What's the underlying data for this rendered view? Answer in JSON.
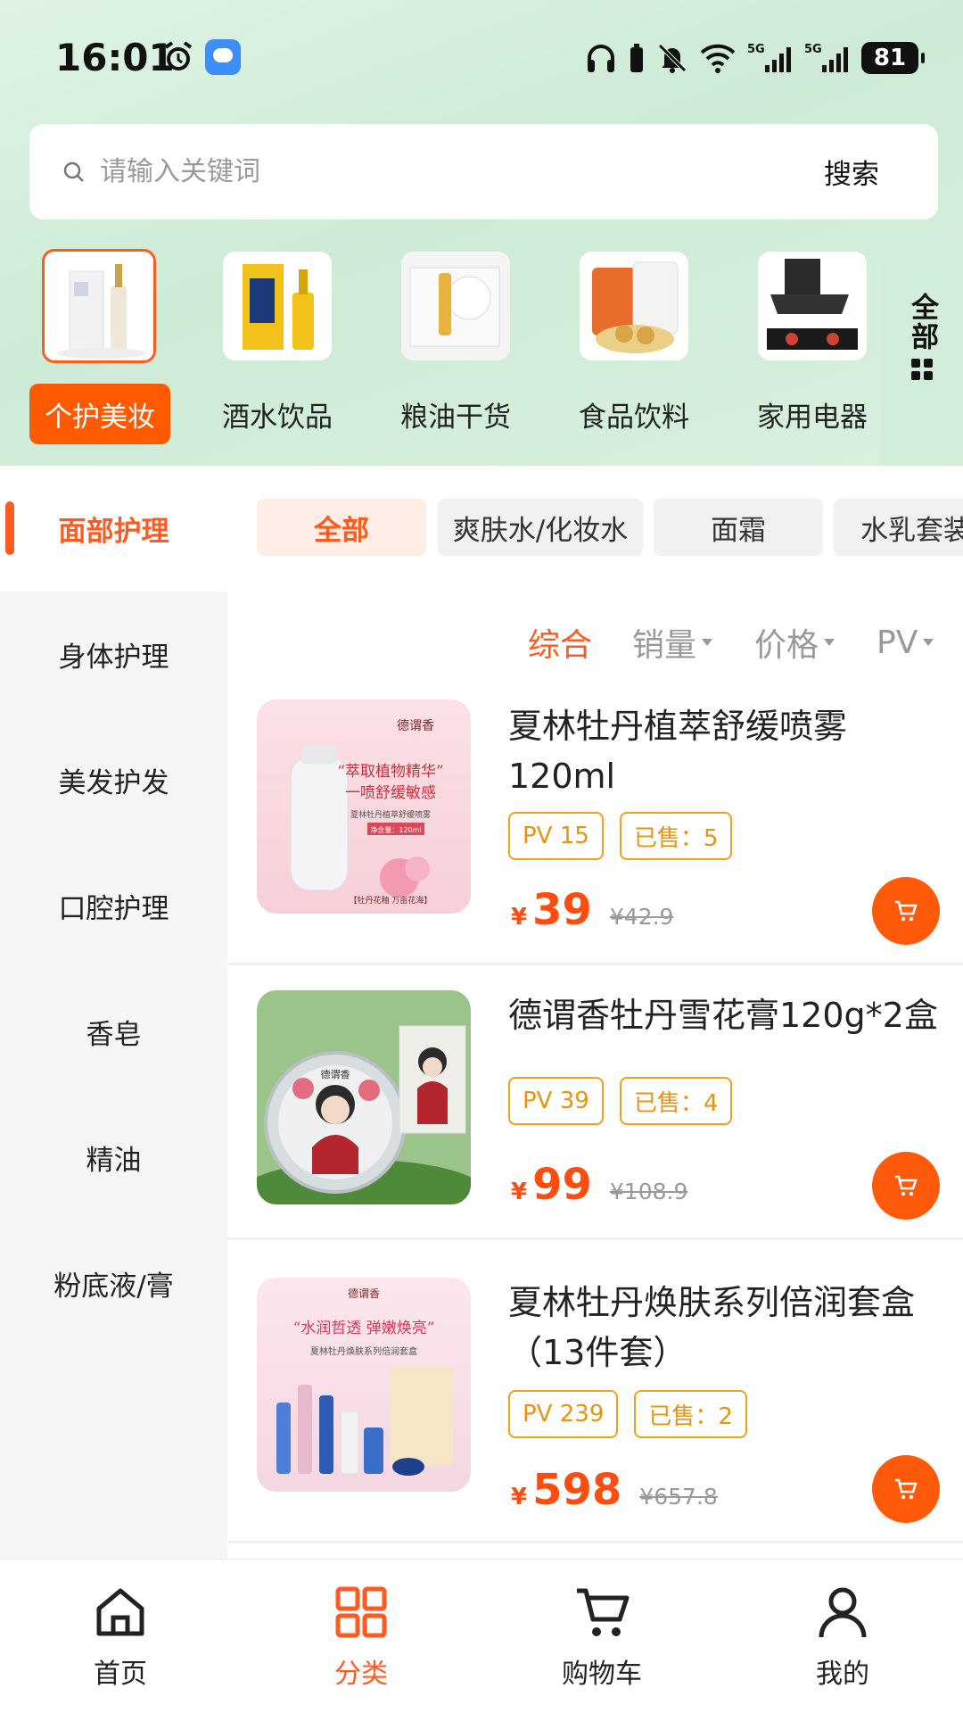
{
  "status_bar": {
    "time": "16:01",
    "battery": "81",
    "network1": "5G",
    "network2": "5G"
  },
  "search": {
    "placeholder": "请输入关键词",
    "button_label": "搜索"
  },
  "categories": [
    {
      "label": "个护美妆",
      "active": true
    },
    {
      "label": "酒水饮品",
      "active": false
    },
    {
      "label": "粮油干货",
      "active": false
    },
    {
      "label": "食品饮料",
      "active": false
    },
    {
      "label": "家用电器",
      "active": false
    }
  ],
  "all_categories_label": "全部",
  "sidebar": {
    "items": [
      {
        "label": "面部护理",
        "active": true
      },
      {
        "label": "身体护理"
      },
      {
        "label": "美发护发"
      },
      {
        "label": "口腔护理"
      },
      {
        "label": "香皂"
      },
      {
        "label": "精油"
      },
      {
        "label": "粉底液/膏"
      }
    ]
  },
  "subtabs": [
    {
      "label": "全部",
      "active": true
    },
    {
      "label": "爽肤水/化妆水"
    },
    {
      "label": "面霜"
    },
    {
      "label": "水乳套装"
    }
  ],
  "sort_options": [
    {
      "label": "综合",
      "active": true
    },
    {
      "label": "销量"
    },
    {
      "label": "价格"
    },
    {
      "label": "PV"
    }
  ],
  "products": [
    {
      "name": "夏林牡丹植萃舒缓喷雾120ml",
      "pv": "PV 15",
      "sold": "已售：5",
      "currency": "¥",
      "price": "39",
      "original_price": "¥42.9",
      "image_text": {
        "brand": "德谓香",
        "headline1": "“萃取植物精华”",
        "headline2": "一喷舒缓敏感",
        "sub": "夏林牡丹植萃舒缓喷雾",
        "badge": "净含量：120ml",
        "foot": "【牡丹花釉 万亩花海】"
      }
    },
    {
      "name": "德谓香牡丹雪花膏120g*2盒",
      "pv": "PV 39",
      "sold": "已售：4",
      "currency": "¥",
      "price": "99",
      "original_price": "¥108.9",
      "image_text": {
        "brand": "德谓香"
      }
    },
    {
      "name": "夏林牡丹焕肤系列倍润套盒（13件套）",
      "pv": "PV 239",
      "sold": "已售：2",
      "currency": "¥",
      "price": "598",
      "original_price": "¥657.8",
      "image_text": {
        "brand": "德谓香",
        "headline": "“水润哲透 弹嫩焕亮”",
        "sub": "夏林牡丹焕肤系列倍润套盒"
      }
    }
  ],
  "bottom_nav": [
    {
      "label": "首页",
      "icon": "home-icon"
    },
    {
      "label": "分类",
      "icon": "grid-icon",
      "active": true
    },
    {
      "label": "购物车",
      "icon": "cart-icon"
    },
    {
      "label": "我的",
      "icon": "user-icon"
    }
  ],
  "colors": {
    "accent": "#ff5a1f",
    "tag": "#e89412",
    "header_bg": "#d6efdc"
  }
}
